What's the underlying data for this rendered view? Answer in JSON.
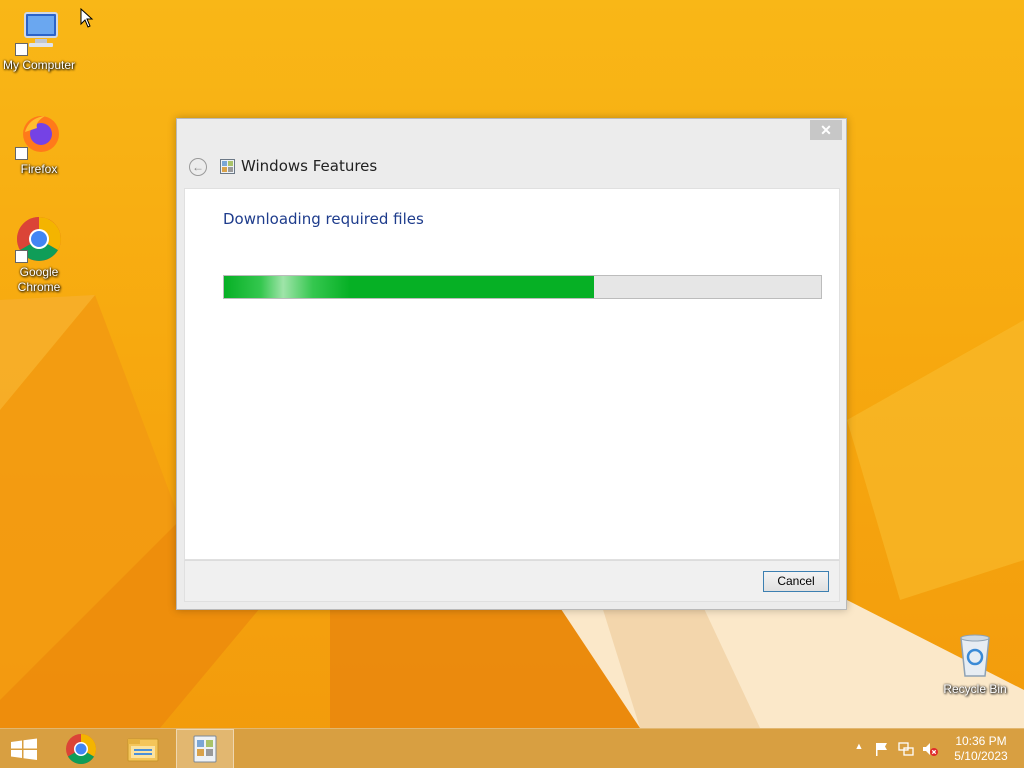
{
  "desktop": {
    "icons": [
      {
        "label": "My Computer",
        "icon": "my-computer-icon"
      },
      {
        "label": "Firefox",
        "icon": "firefox-icon"
      },
      {
        "label": "Google\nChrome",
        "icon": "chrome-icon"
      },
      {
        "label": "Recycle Bin",
        "icon": "recycle-bin-icon"
      }
    ]
  },
  "dialog": {
    "title": "Windows Features",
    "close_glyph": "✕",
    "back_glyph": "←",
    "status_heading": "Downloading required files",
    "progress_fraction": 0.62,
    "cancel_label": "Cancel"
  },
  "taskbar": {
    "items": [
      "start-button",
      "chrome-icon",
      "file-explorer-icon",
      "windows-features-icon"
    ],
    "tray": {
      "overflow_glyph": "▲",
      "time": "10:36 PM",
      "date": "5/10/2023"
    }
  },
  "colors": {
    "desktop_bg": "#f7a90f",
    "progress_green": "#06b025",
    "heading_blue": "#1e3c8c",
    "button_border": "#3c7fb1"
  }
}
